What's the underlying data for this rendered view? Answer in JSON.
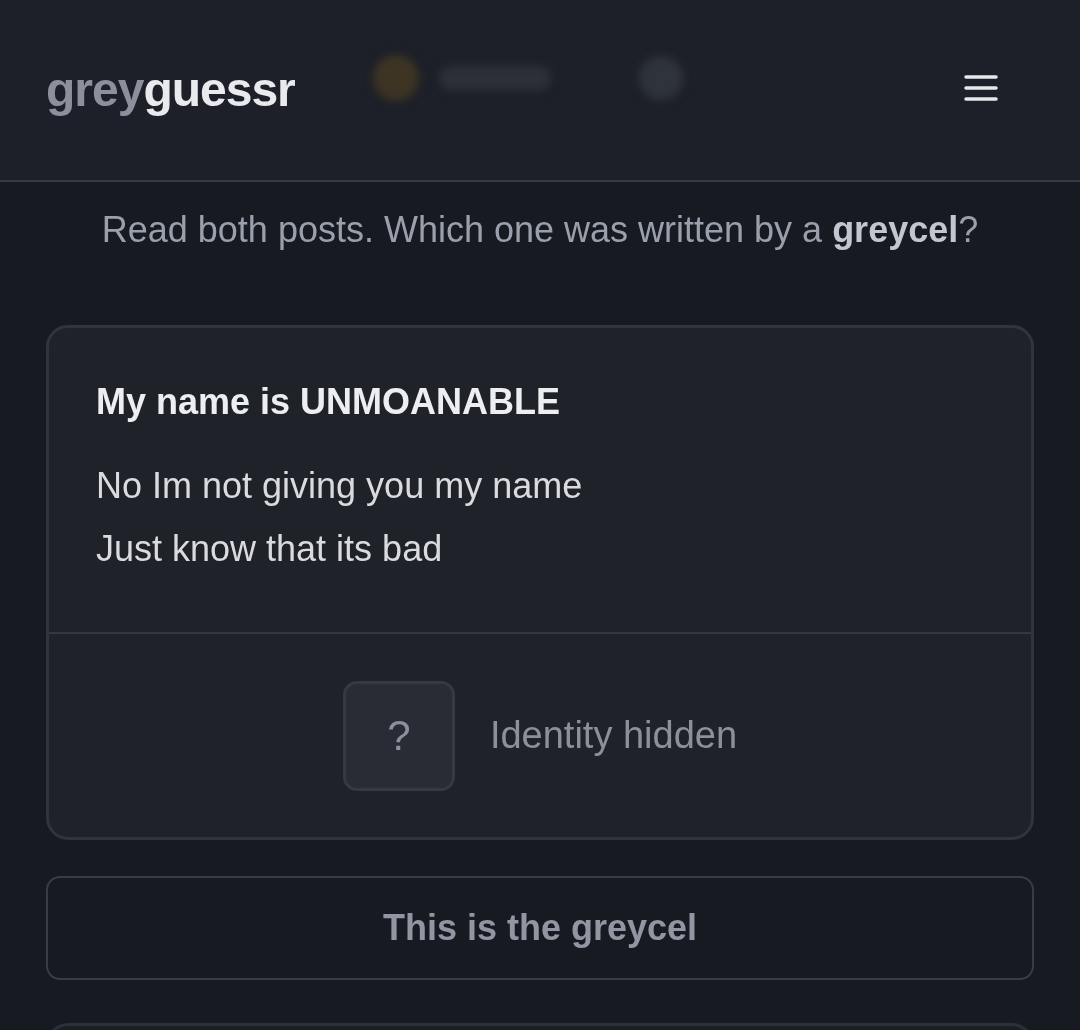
{
  "header": {
    "logo": {
      "muted": "grey",
      "bright": "guessr"
    }
  },
  "prompt": "Read both posts. Which one was written by a **greycel**?",
  "post": {
    "title": "My name is UNMOANABLE",
    "body": [
      "No Im not giving you my name",
      "Just know that its bad"
    ],
    "author": {
      "avatar_symbol": "?",
      "label": "Identity hidden"
    }
  },
  "choose_button": "This is the greycel"
}
